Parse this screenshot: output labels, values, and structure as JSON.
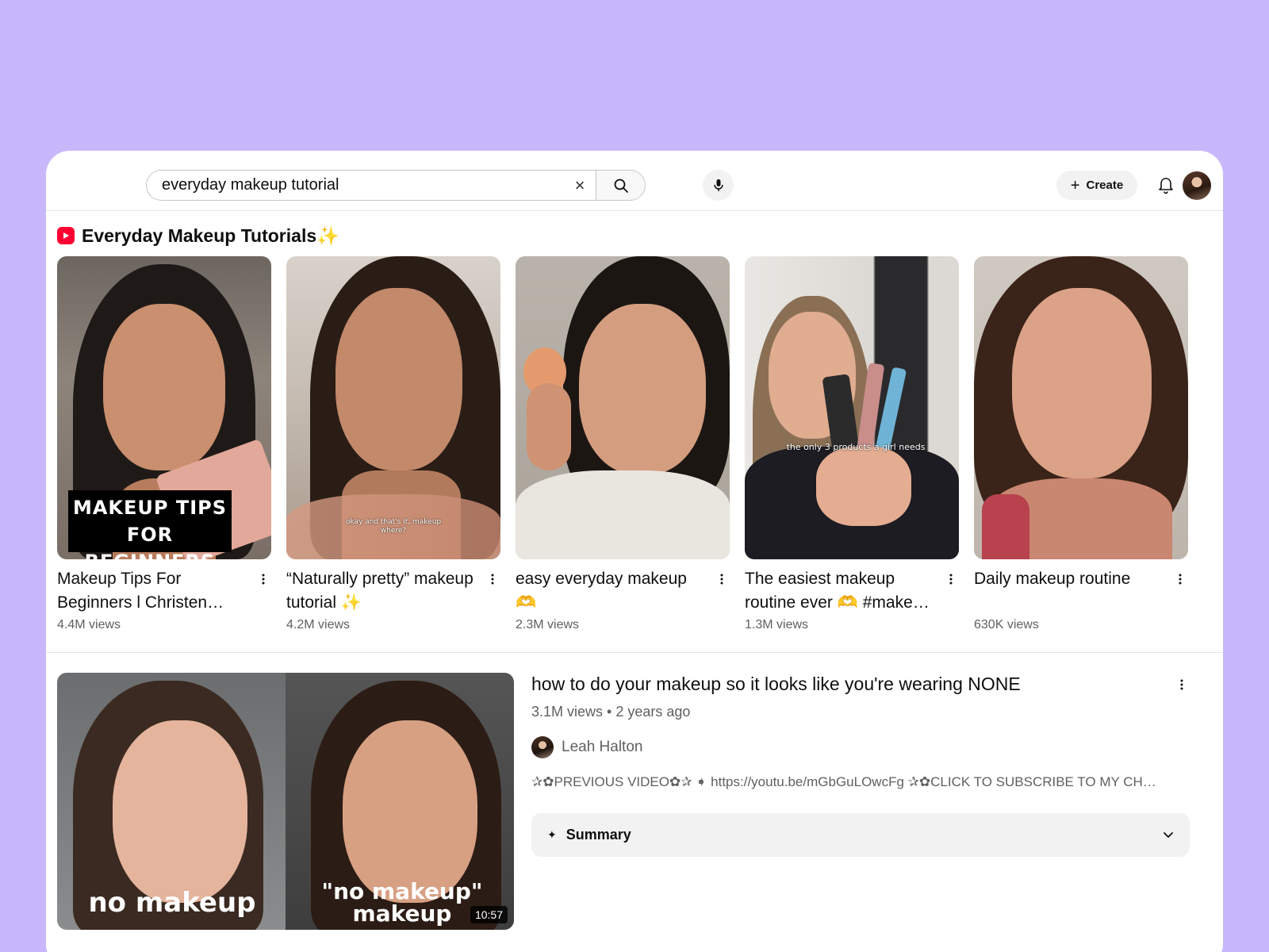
{
  "search": {
    "query": "everyday makeup tutorial"
  },
  "header": {
    "create_label": "Create"
  },
  "shelf": {
    "title": "Everyday Makeup Tutorials✨",
    "items": [
      {
        "title": "Makeup Tips For Beginners l Christen…",
        "views": "4.4M views",
        "overlay": "MAKEUP TIPS FOR BEGINNERS"
      },
      {
        "title": "“Naturally pretty” makeup tutorial ✨",
        "views": "4.2M views",
        "overlay": "okay and that's it, makeup where?"
      },
      {
        "title": "easy everyday makeup 🫶",
        "views": "2.3M views",
        "overlay": ""
      },
      {
        "title": "The easiest makeup routine ever 🫶 #make…",
        "views": "1.3M views",
        "overlay": "the only 3 products a girl needs"
      },
      {
        "title": "Daily makeup routine",
        "views": "630K views",
        "overlay": ""
      }
    ]
  },
  "video": {
    "title": "how to do your makeup so it looks like you're wearing NONE",
    "meta": "3.1M views • 2 years ago",
    "channel": "Leah Halton",
    "description": "✰✿PREVIOUS VIDEO✿✰ ➧ https://youtu.be/mGbGuLOwcFg ✰✿CLICK TO SUBSCRIBE TO MY CH…",
    "duration": "10:57",
    "thumb_left_text": "no makeup",
    "thumb_right_text": "\"no makeup\" makeup",
    "summary_label": "Summary"
  },
  "colors": {
    "background": "#c8b8fb",
    "shorts_red": "#ff0033"
  }
}
